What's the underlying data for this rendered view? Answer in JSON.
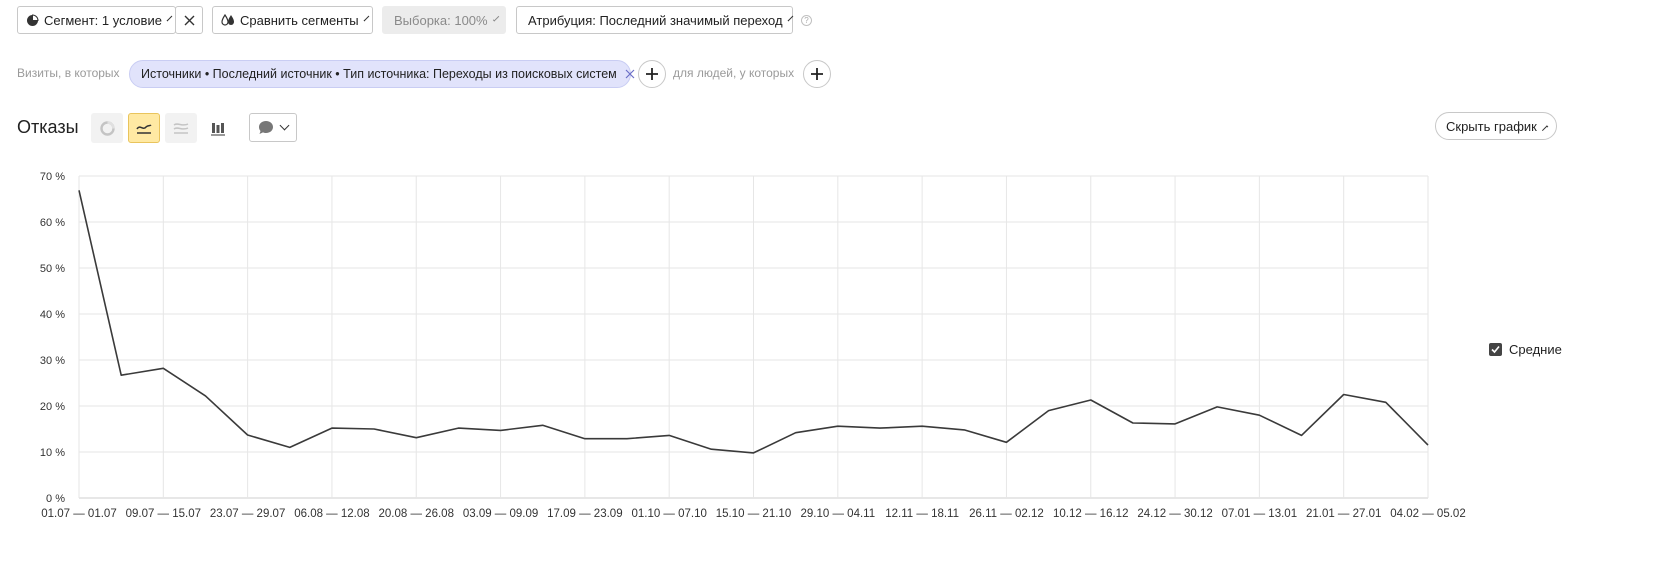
{
  "toolbar": {
    "segment_label": "Сегмент: 1 условие",
    "compare_label": "Сравнить сегменты",
    "sample_label": "Выборка: 100%",
    "attribution_label": "Атрибуция: Последний значимый переход",
    "help_label": "?"
  },
  "filters": {
    "visits_label": "Визиты, в которых",
    "chip_label": "Источники • Последний источник • Тип источника: Переходы из поисковых систем",
    "people_label": "для людей, у которых"
  },
  "report": {
    "title": "Отказы",
    "hide_chart_label": "Скрыть график"
  },
  "legend": {
    "averages_label": "Средние",
    "averages_checked": true
  },
  "colors": {
    "line": "#3a3a3a",
    "grid": "#e6e6e6",
    "active_view": "#ffe9a3",
    "chip": "#e1e3fb"
  },
  "chart_data": {
    "type": "line",
    "ylim": [
      0,
      70
    ],
    "y_ticks": [
      0,
      10,
      20,
      30,
      40,
      50,
      60,
      70
    ],
    "y_tick_labels": [
      "0 %",
      "10 %",
      "20 %",
      "30 %",
      "40 %",
      "50 %",
      "60 %",
      "70 %"
    ],
    "x_tick_labels": [
      "01.07 — 01.07",
      "09.07 — 15.07",
      "23.07 — 29.07",
      "06.08 — 12.08",
      "20.08 — 26.08",
      "03.09 — 09.09",
      "17.09 — 23.09",
      "01.10 — 07.10",
      "15.10 — 21.10",
      "29.10 — 04.11",
      "12.11 — 18.11",
      "26.11 — 02.12",
      "10.12 — 16.12",
      "24.12 — 30.12",
      "07.01 — 13.01",
      "21.01 — 27.01",
      "04.02 — 05.02"
    ],
    "values": [
      66.9,
      26.7,
      28.2,
      22.2,
      13.7,
      11.0,
      15.2,
      15.0,
      13.1,
      15.2,
      14.7,
      15.8,
      12.9,
      12.9,
      13.6,
      10.6,
      9.8,
      14.2,
      15.6,
      15.2,
      15.6,
      14.8,
      12.1,
      19.0,
      21.3,
      16.3,
      16.1,
      19.8,
      18.0,
      13.6,
      22.5,
      20.8,
      11.5
    ]
  }
}
